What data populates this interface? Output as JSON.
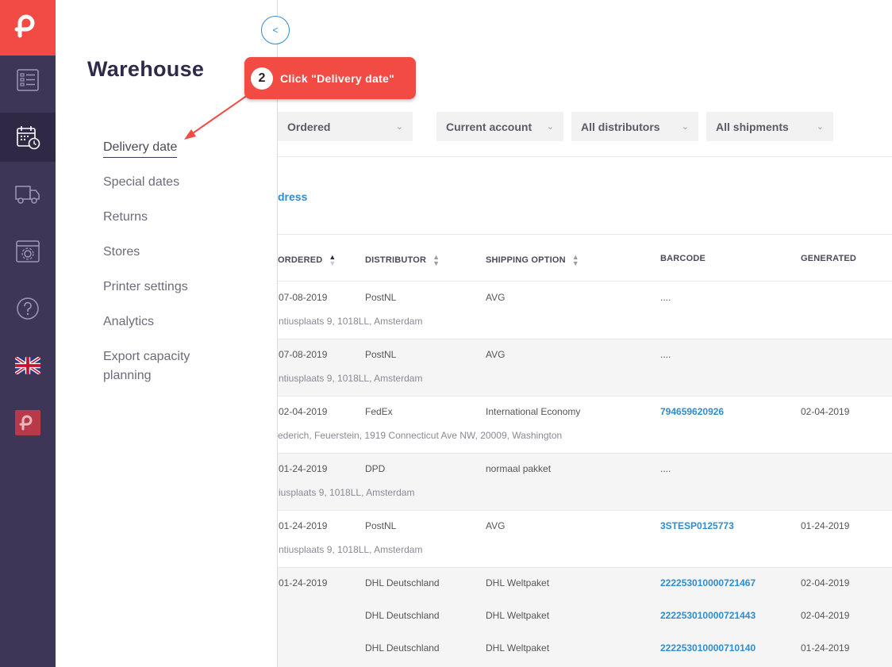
{
  "rail": {
    "icons": [
      "logo-icon",
      "orders-icon",
      "calendar-clock-icon",
      "truck-icon",
      "settings-window-icon",
      "help-icon",
      "uk-flag-icon",
      "brand-icon"
    ]
  },
  "submenu": {
    "title": "Warehouse",
    "items": [
      {
        "label": "Delivery date"
      },
      {
        "label": "Special dates"
      },
      {
        "label": "Returns"
      },
      {
        "label": "Stores"
      },
      {
        "label": "Printer settings"
      },
      {
        "label": "Analytics"
      },
      {
        "label": "Export capacity\nplanning"
      }
    ],
    "collapse_label": "<"
  },
  "callout": {
    "step": "2",
    "text": "Click \"Delivery date\""
  },
  "filters": [
    {
      "label": "Ordered"
    },
    {
      "label": "Current account"
    },
    {
      "label": "All distributors"
    },
    {
      "label": "All shipments"
    }
  ],
  "address_tab": "dress",
  "table": {
    "columns": {
      "ordered": "ORDERED",
      "distributor": "DISTRIBUTOR",
      "shipping": "SHIPPING OPTION",
      "barcode": "BARCODE",
      "generated": "GENERATED"
    },
    "rows": [
      {
        "ordered": "07-08-2019",
        "distributor": "PostNL",
        "shipping": "AVG",
        "barcode": "....",
        "generated": "",
        "address": "ntiusplaats 9, 1018LL, Amsterdam"
      },
      {
        "ordered": "07-08-2019",
        "distributor": "PostNL",
        "shipping": "AVG",
        "barcode": "....",
        "generated": "",
        "address": "ntiusplaats 9, 1018LL, Amsterdam"
      },
      {
        "ordered": "02-04-2019",
        "distributor": "FedEx",
        "shipping": "International Economy",
        "barcode": "794659620926",
        "generated": "02-04-2019",
        "address": "ederich, Feuerstein, 1919 Connecticut Ave NW, 20009, Washington"
      },
      {
        "ordered": "01-24-2019",
        "distributor": "DPD",
        "shipping": "normaal pakket",
        "barcode": "....",
        "generated": "",
        "address": "iusplaats 9, 1018LL, Amsterdam"
      },
      {
        "ordered": "01-24-2019",
        "distributor": "PostNL",
        "shipping": "AVG",
        "barcode": "3STESP0125773",
        "generated": "01-24-2019",
        "address": "ntiusplaats 9, 1018LL, Amsterdam"
      }
    ],
    "group": {
      "ordered": "01-24-2019",
      "lines": [
        {
          "distributor": "DHL Deutschland",
          "shipping": "DHL Weltpaket",
          "barcode": "222253010000721467",
          "generated": "02-04-2019"
        },
        {
          "distributor": "DHL Deutschland",
          "shipping": "DHL Weltpaket",
          "barcode": "222253010000721443",
          "generated": "02-04-2019"
        },
        {
          "distributor": "DHL Deutschland",
          "shipping": "DHL Weltpaket",
          "barcode": "222253010000710140",
          "generated": "01-24-2019"
        }
      ]
    }
  },
  "colors": {
    "accent_red": "#f24b44",
    "rail_bg": "#3d3656",
    "link_blue": "#2f8ccf"
  }
}
